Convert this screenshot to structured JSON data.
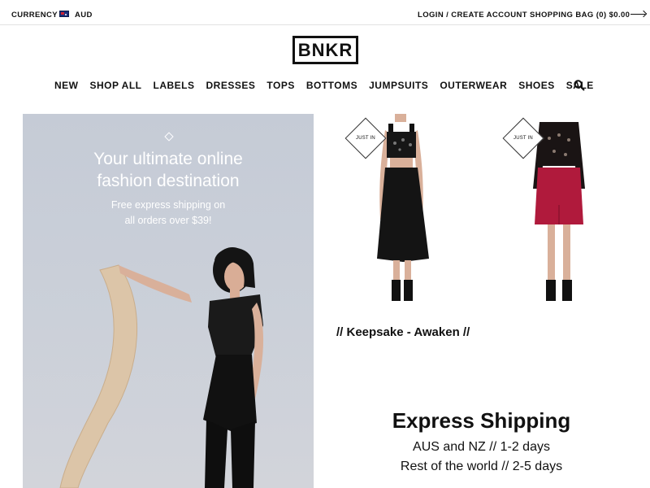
{
  "topbar": {
    "currency_label": "CURRENCY",
    "currency_value": "AUD",
    "flag_icon": "australia-flag-icon",
    "login": "LOGIN / CREATE ACCOUNT",
    "bag": "SHOPPING BAG (0) $0.00",
    "arrow_icon": "arrow-right-icon"
  },
  "logo": "BNKR",
  "nav": [
    "NEW",
    "SHOP ALL",
    "LABELS",
    "DRESSES",
    "TOPS",
    "BOTTOMS",
    "JUMPSUITS",
    "OUTERWEAR",
    "SHOES",
    "SALE"
  ],
  "search_icon": "search-icon",
  "hero": {
    "headline_line1": "Your ultimate online",
    "headline_line2": "fashion destination",
    "sub_line1": "Free express shipping on",
    "sub_line2": "all orders over $39!"
  },
  "products": [
    {
      "badge": "JUST IN"
    },
    {
      "badge": "JUST IN"
    }
  ],
  "collection": "// Keepsake - Awaken //",
  "shipping": {
    "title": "Express Shipping",
    "line1": "AUS and NZ  //  1-2 days",
    "line2": "Rest of the world  //  2-5 days"
  },
  "colors": {
    "text": "#111111",
    "hero_bg": "#c8cdd7",
    "skirt": "#b01a3c"
  }
}
